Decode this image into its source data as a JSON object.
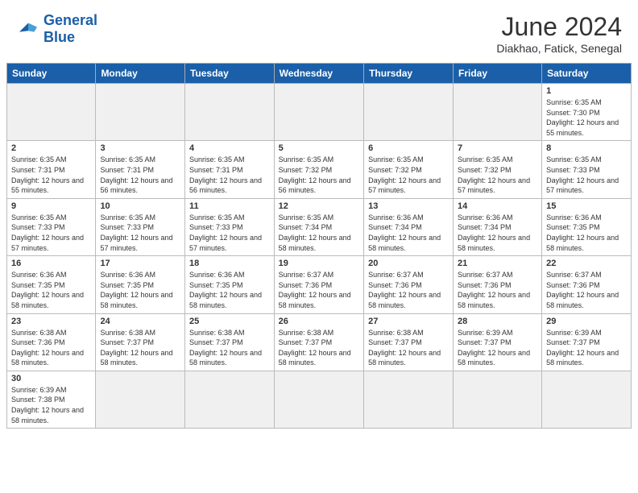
{
  "logo": {
    "text_general": "General",
    "text_blue": "Blue"
  },
  "title": "June 2024",
  "subtitle": "Diakhao, Fatick, Senegal",
  "days_of_week": [
    "Sunday",
    "Monday",
    "Tuesday",
    "Wednesday",
    "Thursday",
    "Friday",
    "Saturday"
  ],
  "weeks": [
    [
      {
        "num": "",
        "empty": true
      },
      {
        "num": "",
        "empty": true
      },
      {
        "num": "",
        "empty": true
      },
      {
        "num": "",
        "empty": true
      },
      {
        "num": "",
        "empty": true
      },
      {
        "num": "",
        "empty": true
      },
      {
        "num": "1",
        "sunrise": "6:35 AM",
        "sunset": "7:30 PM",
        "daylight": "12 hours and 55 minutes."
      }
    ],
    [
      {
        "num": "2",
        "sunrise": "6:35 AM",
        "sunset": "7:31 PM",
        "daylight": "12 hours and 55 minutes."
      },
      {
        "num": "3",
        "sunrise": "6:35 AM",
        "sunset": "7:31 PM",
        "daylight": "12 hours and 56 minutes."
      },
      {
        "num": "4",
        "sunrise": "6:35 AM",
        "sunset": "7:31 PM",
        "daylight": "12 hours and 56 minutes."
      },
      {
        "num": "5",
        "sunrise": "6:35 AM",
        "sunset": "7:32 PM",
        "daylight": "12 hours and 56 minutes."
      },
      {
        "num": "6",
        "sunrise": "6:35 AM",
        "sunset": "7:32 PM",
        "daylight": "12 hours and 57 minutes."
      },
      {
        "num": "7",
        "sunrise": "6:35 AM",
        "sunset": "7:32 PM",
        "daylight": "12 hours and 57 minutes."
      },
      {
        "num": "8",
        "sunrise": "6:35 AM",
        "sunset": "7:33 PM",
        "daylight": "12 hours and 57 minutes."
      }
    ],
    [
      {
        "num": "9",
        "sunrise": "6:35 AM",
        "sunset": "7:33 PM",
        "daylight": "12 hours and 57 minutes."
      },
      {
        "num": "10",
        "sunrise": "6:35 AM",
        "sunset": "7:33 PM",
        "daylight": "12 hours and 57 minutes."
      },
      {
        "num": "11",
        "sunrise": "6:35 AM",
        "sunset": "7:33 PM",
        "daylight": "12 hours and 57 minutes."
      },
      {
        "num": "12",
        "sunrise": "6:35 AM",
        "sunset": "7:34 PM",
        "daylight": "12 hours and 58 minutes."
      },
      {
        "num": "13",
        "sunrise": "6:36 AM",
        "sunset": "7:34 PM",
        "daylight": "12 hours and 58 minutes."
      },
      {
        "num": "14",
        "sunrise": "6:36 AM",
        "sunset": "7:34 PM",
        "daylight": "12 hours and 58 minutes."
      },
      {
        "num": "15",
        "sunrise": "6:36 AM",
        "sunset": "7:35 PM",
        "daylight": "12 hours and 58 minutes."
      }
    ],
    [
      {
        "num": "16",
        "sunrise": "6:36 AM",
        "sunset": "7:35 PM",
        "daylight": "12 hours and 58 minutes."
      },
      {
        "num": "17",
        "sunrise": "6:36 AM",
        "sunset": "7:35 PM",
        "daylight": "12 hours and 58 minutes."
      },
      {
        "num": "18",
        "sunrise": "6:36 AM",
        "sunset": "7:35 PM",
        "daylight": "12 hours and 58 minutes."
      },
      {
        "num": "19",
        "sunrise": "6:37 AM",
        "sunset": "7:36 PM",
        "daylight": "12 hours and 58 minutes."
      },
      {
        "num": "20",
        "sunrise": "6:37 AM",
        "sunset": "7:36 PM",
        "daylight": "12 hours and 58 minutes."
      },
      {
        "num": "21",
        "sunrise": "6:37 AM",
        "sunset": "7:36 PM",
        "daylight": "12 hours and 58 minutes."
      },
      {
        "num": "22",
        "sunrise": "6:37 AM",
        "sunset": "7:36 PM",
        "daylight": "12 hours and 58 minutes."
      }
    ],
    [
      {
        "num": "23",
        "sunrise": "6:38 AM",
        "sunset": "7:36 PM",
        "daylight": "12 hours and 58 minutes."
      },
      {
        "num": "24",
        "sunrise": "6:38 AM",
        "sunset": "7:37 PM",
        "daylight": "12 hours and 58 minutes."
      },
      {
        "num": "25",
        "sunrise": "6:38 AM",
        "sunset": "7:37 PM",
        "daylight": "12 hours and 58 minutes."
      },
      {
        "num": "26",
        "sunrise": "6:38 AM",
        "sunset": "7:37 PM",
        "daylight": "12 hours and 58 minutes."
      },
      {
        "num": "27",
        "sunrise": "6:38 AM",
        "sunset": "7:37 PM",
        "daylight": "12 hours and 58 minutes."
      },
      {
        "num": "28",
        "sunrise": "6:39 AM",
        "sunset": "7:37 PM",
        "daylight": "12 hours and 58 minutes."
      },
      {
        "num": "29",
        "sunrise": "6:39 AM",
        "sunset": "7:37 PM",
        "daylight": "12 hours and 58 minutes."
      }
    ],
    [
      {
        "num": "30",
        "sunrise": "6:39 AM",
        "sunset": "7:38 PM",
        "daylight": "12 hours and 58 minutes."
      },
      {
        "num": "",
        "empty": true
      },
      {
        "num": "",
        "empty": true
      },
      {
        "num": "",
        "empty": true
      },
      {
        "num": "",
        "empty": true
      },
      {
        "num": "",
        "empty": true
      },
      {
        "num": "",
        "empty": true
      }
    ]
  ],
  "labels": {
    "sunrise": "Sunrise:",
    "sunset": "Sunset:",
    "daylight": "Daylight:"
  }
}
